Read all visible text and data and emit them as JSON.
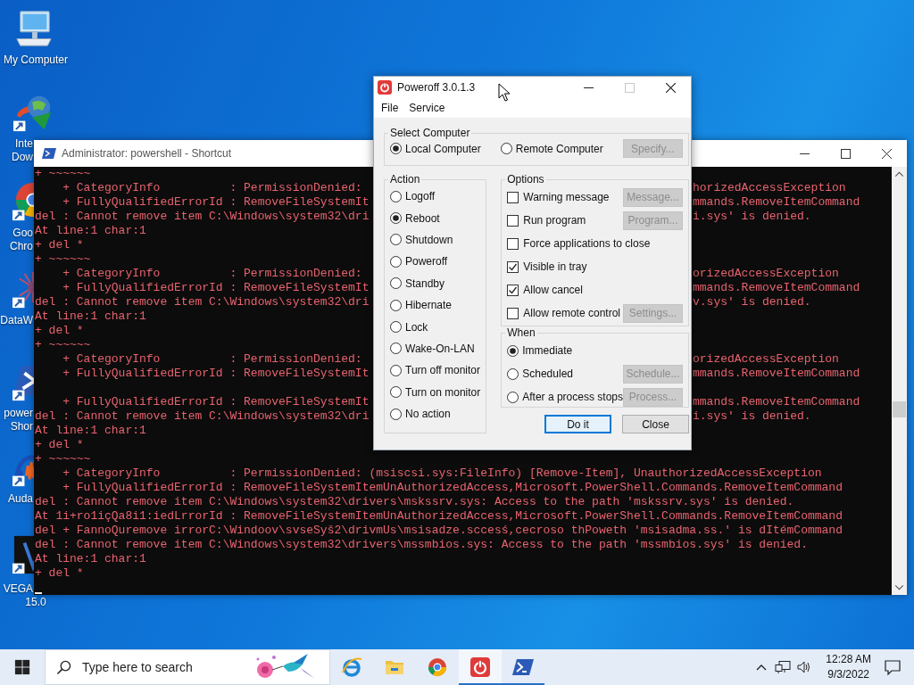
{
  "desktop_icons": [
    {
      "kind": "monitor",
      "lines": [
        "My Computer"
      ]
    },
    {
      "kind": "download",
      "lines": [
        "Inte",
        "Dow"
      ]
    },
    {
      "kind": "chrome",
      "lines": [
        "Goo",
        "Chro"
      ]
    },
    {
      "kind": "data",
      "lines": [
        "DataW"
      ]
    },
    {
      "kind": "shell",
      "lines": [
        "power",
        "Shor"
      ]
    },
    {
      "kind": "audio",
      "lines": [
        "Auda"
      ]
    },
    {
      "kind": "video",
      "lines": [
        "VEGA",
        "15.0"
      ]
    }
  ],
  "console": {
    "title": "Administrator: powershell - Shortcut",
    "lines": [
      {
        "left": "+ ~~~~~~"
      },
      {
        "left": "    + CategoryInfo          : PermissionDenied:",
        "right": "horizedAccessException"
      },
      {
        "left": "    + FullyQualifiedErrorId : RemoveFileSystemIt",
        "right": "mmands.RemoveItemCommand"
      },
      {
        "left": "del : Cannot remove item C:\\Windows\\system32\\dri",
        "right": "i.sys' is denied."
      },
      {
        "left": "At line:1 char:1"
      },
      {
        "left": "+ del *"
      },
      {
        "left": "+ ~~~~~~"
      },
      {
        "left": "    + CategoryInfo          : PermissionDenied:",
        "right": "orizedAccessException"
      },
      {
        "left": "    + FullyQualifiedErrorId : RemoveFileSystemIt",
        "right": "mmands.RemoveItemCommand"
      },
      {
        "left": "del : Cannot remove item C:\\Windows\\system32\\dri",
        "right": "v.sys' is denied."
      },
      {
        "left": "At line:1 char:1"
      },
      {
        "left": "+ del *"
      },
      {
        "left": "+ ~~~~~~"
      },
      {
        "left": "    + CategoryInfo          : PermissionDenied:",
        "right": "orizedAccessException"
      },
      {
        "left": "    + FullyQualifiedErrorId : RemoveFileSystemIt",
        "right": "mmands.RemoveItemCommand"
      },
      {
        "blank_before": true,
        "left": "    + FullyQualifiedErrorId : RemoveFileSystemIt",
        "right": "mmands.RemoveItemCommand"
      },
      {
        "left": "del : Cannot remove item C:\\Windows\\system32\\dri",
        "right": "i.sys' is denied."
      },
      {
        "left": "At line:1 char:1"
      },
      {
        "left": "+ del *"
      },
      {
        "left": "+ ~~~~~~"
      },
      {
        "left": "    + CategoryInfo          : PermissionDenied: (msiscsi.sys:FileInfo) [Remove-Item], UnauthorizedAccessException"
      },
      {
        "left": "    + FullyQualifiedErrorId : RemoveFileSystemItemUnAuthorizedAccess,Microsoft.PowerShell.Commands.RemoveItemCommand"
      },
      {
        "left": "del : Cannot remove item C:\\Windows\\system32\\drivers\\mskssrv.sys: Access to the path 'mskssrv.sys' is denied."
      },
      {
        "left": "At 1i+ro1içQa8i1:iedLrrorId : RemoveFileSystemItemUnAuthorizedAccess,Microsoft.PowerShell.Commands.RemoveItemCommand"
      },
      {
        "left": "del + FannoQuremove irrorC:\\Windoov\\svseSyš2\\drivmUs\\msisadze.sccesś,cecroso thPoweth 'msisadma.ss.' is dItémCommand"
      },
      {
        "left": "del : Cannot remove item C:\\Windows\\system32\\drivers\\mssmbios.sys: Access to the path 'mssmbios.sys' is denied."
      },
      {
        "left": "At line:1 char:1"
      },
      {
        "left": "+ del *"
      }
    ]
  },
  "dialog": {
    "title": "Poweroff 3.0.1.3",
    "menu": [
      "File",
      "Service"
    ],
    "select_computer": {
      "label": "Select Computer",
      "options": [
        {
          "label": "Local Computer",
          "selected": true
        },
        {
          "label": "Remote Computer",
          "selected": false
        }
      ],
      "button": {
        "label": "Specify...",
        "disabled": true
      }
    },
    "action": {
      "label": "Action",
      "options": [
        {
          "label": "Logoff",
          "selected": false
        },
        {
          "label": "Reboot",
          "selected": true
        },
        {
          "label": "Shutdown",
          "selected": false
        },
        {
          "label": "Poweroff",
          "selected": false
        },
        {
          "label": "Standby",
          "selected": false
        },
        {
          "label": "Hibernate",
          "selected": false
        },
        {
          "label": "Lock",
          "selected": false
        },
        {
          "label": "Wake-On-LAN",
          "selected": false
        },
        {
          "label": "Turn off monitor",
          "selected": false
        },
        {
          "label": "Turn on monitor",
          "selected": false
        },
        {
          "label": "No action",
          "selected": false
        }
      ]
    },
    "options": {
      "label": "Options",
      "items": [
        {
          "label": "Warning message",
          "checked": false,
          "button": {
            "label": "Message...",
            "disabled": true
          }
        },
        {
          "label": "Run program",
          "checked": false,
          "button": {
            "label": "Program...",
            "disabled": true
          }
        },
        {
          "label": "Force applications to close",
          "checked": false
        },
        {
          "label": "Visible in tray",
          "checked": true
        },
        {
          "label": "Allow cancel",
          "checked": true
        },
        {
          "label": "Allow remote control",
          "checked": false,
          "button": {
            "label": "Settings...",
            "disabled": true
          }
        }
      ]
    },
    "when": {
      "label": "When",
      "options": [
        {
          "label": "Immediate",
          "selected": true
        },
        {
          "label": "Scheduled",
          "selected": false,
          "button": {
            "label": "Schedule...",
            "disabled": true
          }
        },
        {
          "label": "After a process stops",
          "selected": false,
          "button": {
            "label": "Process...",
            "disabled": true
          }
        }
      ]
    },
    "buttons": [
      {
        "label": "Do it",
        "default": true
      },
      {
        "label": "Close",
        "default": false
      }
    ]
  },
  "taskbar": {
    "search_placeholder": "Type here to search",
    "apps": [
      {
        "kind": "ie",
        "selected": false,
        "running": false
      },
      {
        "kind": "folder",
        "selected": false,
        "running": false
      },
      {
        "kind": "chrome",
        "selected": false,
        "running": false
      },
      {
        "kind": "poweroff",
        "selected": true,
        "running": true
      },
      {
        "kind": "shell",
        "selected": false,
        "running": true
      }
    ],
    "clock": {
      "time": "12:28 AM",
      "date": "9/3/2022"
    }
  }
}
